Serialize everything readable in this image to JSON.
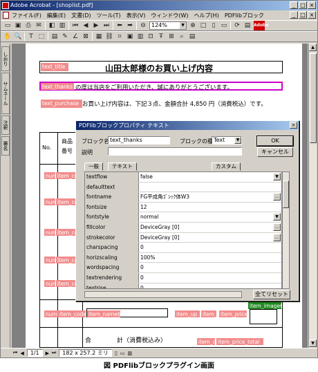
{
  "window": {
    "app_title": "Adobe Acrobat - [shoplist.pdf]",
    "btn_min": "_",
    "btn_max": "□",
    "btn_close": "×"
  },
  "menu": [
    "ファイル(F)",
    "編集(E)",
    "文書(D)",
    "ツール(T)",
    "表示(V)",
    "ウィンドウ(W)",
    "ヘルプ(H)",
    "PDFlibブロック"
  ],
  "toolbar": {
    "zoom": "124%",
    "adobe": "Adobe"
  },
  "lefttabs": [
    "しおり",
    "サムネール",
    "注釈",
    "署名"
  ],
  "page": {
    "title_field": "text_title",
    "title": "山田太郎様のお買い上げ内容",
    "thanks_field": "text_thanks",
    "thanks": "の度は当店をご利用いただき、誠にありがとうございます。",
    "purchase_field": "text_purchase",
    "purchase": "お買い上げ内容は、下記３点、金額合計 4,850 円（消費税込）です。",
    "col_no": "No.",
    "col_item1": "商品",
    "col_item2": "番号",
    "row_fields": [
      "num",
      "item_co"
    ],
    "bottom_fields": [
      "num",
      "item_code",
      "item_name6",
      "item_up",
      "item_c",
      "item_price"
    ],
    "image_field": "item_image6",
    "total_label1": "合",
    "total_label2": "計（消費税込み）",
    "total_fields": [
      "item_c",
      "item_price_total"
    ]
  },
  "dialog": {
    "title": "PDFlibブロックプロパティ テキスト",
    "block_name_label": "ブロック名",
    "block_name_value": "text_thanks",
    "block_type_label": "ブロックの種",
    "block_type_value": "Text",
    "desc_label": "説明",
    "ok": "OK",
    "cancel": "キャンセル",
    "tabs": [
      "一般",
      "テキスト",
      "カスタム"
    ],
    "reset": "全てリセット",
    "props": [
      {
        "name": "textflow",
        "value": "false",
        "btn": "▼"
      },
      {
        "name": "defaulttext",
        "value": "",
        "btn": ""
      },
      {
        "name": "fontname",
        "value": "FG平成角ｺﾞｼｯｸ体W3",
        "btn": "..."
      },
      {
        "name": "fontsize",
        "value": "12",
        "btn": ""
      },
      {
        "name": "fontstyle",
        "value": "normal",
        "btn": "▼"
      },
      {
        "name": "fillcolor",
        "value": "DeviceGray [0]",
        "btn": "..."
      },
      {
        "name": "strokecolor",
        "value": "DeviceGray [0]",
        "btn": "..."
      },
      {
        "name": "charspacing",
        "value": "0",
        "btn": ""
      },
      {
        "name": "horizscaling",
        "value": "100%",
        "btn": ""
      },
      {
        "name": "wordspacing",
        "value": "0",
        "btn": ""
      },
      {
        "name": "textrendering",
        "value": "0",
        "btn": ""
      },
      {
        "name": "textrise",
        "value": "0",
        "btn": ""
      },
      {
        "name": "kerning",
        "value": "false",
        "btn": "▼"
      }
    ]
  },
  "status": {
    "page": "1/1",
    "size": "182 x 257.2 ミリ"
  },
  "caption": "図 PDFlibブロックプラグイン画面"
}
